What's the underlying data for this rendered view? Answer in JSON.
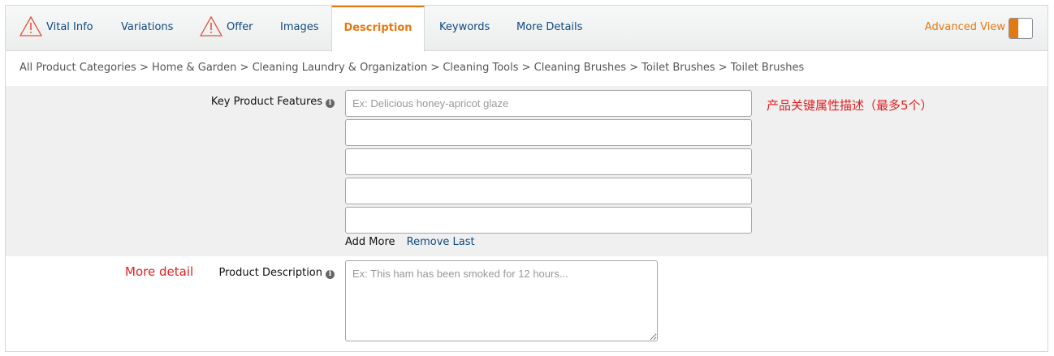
{
  "tabs": [
    {
      "label": "Vital Info",
      "warning": true
    },
    {
      "label": "Variations",
      "warning": false
    },
    {
      "label": "Offer",
      "warning": true
    },
    {
      "label": "Images",
      "warning": false
    },
    {
      "label": "Description",
      "warning": false,
      "active": true
    },
    {
      "label": "Keywords",
      "warning": false
    },
    {
      "label": "More Details",
      "warning": false
    }
  ],
  "advanced_view": {
    "label": "Advanced View",
    "enabled": true
  },
  "breadcrumb": "All Product Categories > Home & Garden > Cleaning Laundry & Organization > Cleaning Tools > Cleaning Brushes > Toilet Brushes > Toilet Brushes",
  "key_features": {
    "label": "Key Product Features",
    "info_icon": "i",
    "placeholder": "Ex: Delicious honey-apricot glaze",
    "values": [
      "",
      "",
      "",
      "",
      ""
    ],
    "annotation": "产品关键属性描述（最多5个）",
    "add_more": "Add More",
    "remove_last": "Remove Last"
  },
  "description": {
    "label": "Product Description",
    "info_icon": "i",
    "placeholder": "Ex: This ham has been smoked for 12 hours...",
    "value": "",
    "annotation": "More detail"
  },
  "colors": {
    "accent": "#e47911",
    "link": "#0f4a80",
    "annotation_red": "#e02020",
    "section_bg": "#f0f0f0"
  }
}
